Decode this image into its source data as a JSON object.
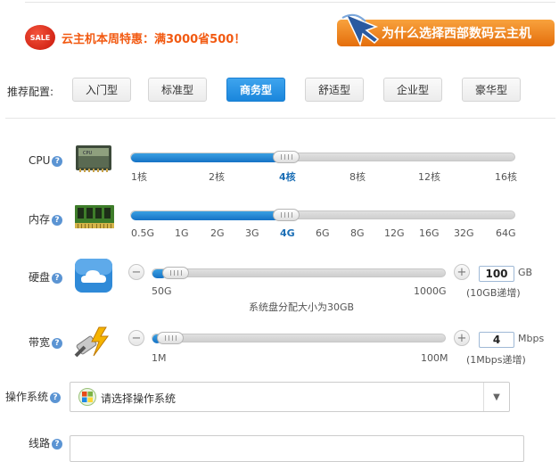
{
  "promo": {
    "sale_badge": "SALE",
    "text": "云主机本周特惠：满3000省500！",
    "why_banner": "为什么选择西部数码云主机"
  },
  "presets": {
    "label": "推荐配置:",
    "items": [
      "入门型",
      "标准型",
      "商务型",
      "舒适型",
      "企业型",
      "豪华型"
    ],
    "selected": "商务型"
  },
  "cpu": {
    "label": "CPU",
    "ticks": [
      "1核",
      "2核",
      "4核",
      "8核",
      "12核",
      "16核"
    ],
    "selected": "4核"
  },
  "memory": {
    "label": "内存",
    "ticks": [
      "0.5G",
      "1G",
      "2G",
      "3G",
      "4G",
      "6G",
      "8G",
      "12G",
      "16G",
      "32G",
      "64G"
    ],
    "selected": "4G"
  },
  "disk": {
    "label": "硬盘",
    "min_label": "50G",
    "max_label": "1000G",
    "value": "100",
    "unit": "GB",
    "step_hint": "(10GB递增)",
    "note": "系统盘分配大小为30GB"
  },
  "bandwidth": {
    "label": "带宽",
    "min_label": "1M",
    "max_label": "100M",
    "value": "4",
    "unit": "Mbps",
    "step_hint": "(1Mbps递增)"
  },
  "os": {
    "label": "操作系统",
    "placeholder": "请选择操作系统"
  },
  "route": {
    "label": "线路"
  },
  "icons": {
    "help": "?",
    "minus": "−",
    "plus": "+",
    "dropdown": "▼"
  },
  "colors": {
    "accent": "#1a86dc",
    "promo": "#f25a12",
    "banner": "#ef8a23",
    "sale": "#d9230f"
  }
}
